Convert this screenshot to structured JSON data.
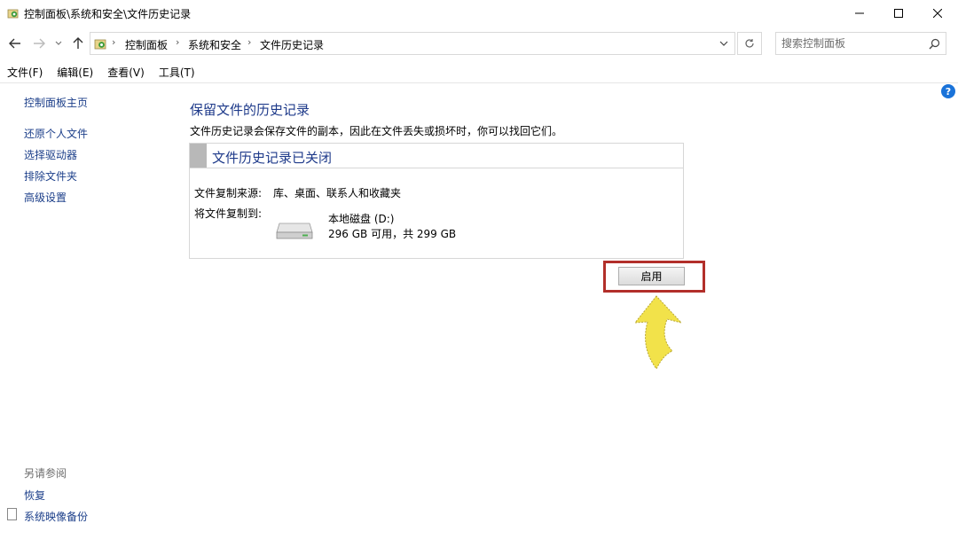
{
  "window": {
    "title": "控制面板\\系统和安全\\文件历史记录",
    "controls": [
      "minimize-icon",
      "maximize-icon",
      "close-icon"
    ]
  },
  "address": {
    "crumbs": [
      "控制面板",
      "系统和安全",
      "文件历史记录"
    ]
  },
  "search": {
    "placeholder": "搜索控制面板"
  },
  "menu": {
    "items": [
      "文件(F)",
      "编辑(E)",
      "查看(V)",
      "工具(T)"
    ]
  },
  "leftnav": {
    "home": "控制面板主页",
    "items": [
      "还原个人文件",
      "选择驱动器",
      "排除文件夹",
      "高级设置"
    ],
    "see_also_title": "另请参阅",
    "see_also": [
      "恢复",
      "系统映像备份"
    ]
  },
  "main": {
    "title": "保留文件的历史记录",
    "description": "文件历史记录会保存文件的副本，因此在文件丢失或损坏时，你可以找回它们。",
    "panel": {
      "status_title": "文件历史记录已关闭",
      "source_label": "文件复制来源:",
      "source_value": "库、桌面、联系人和收藏夹",
      "dest_label": "将文件复制到:",
      "drive_name": "本地磁盘 (D:)",
      "drive_space": "296 GB 可用，共 299 GB"
    },
    "enable_button": "启用"
  },
  "colors": {
    "link": "#1c3f8a",
    "heading": "#1e3a8a",
    "highlight_frame": "#b22f2a",
    "arrow": "#f2e24a"
  }
}
